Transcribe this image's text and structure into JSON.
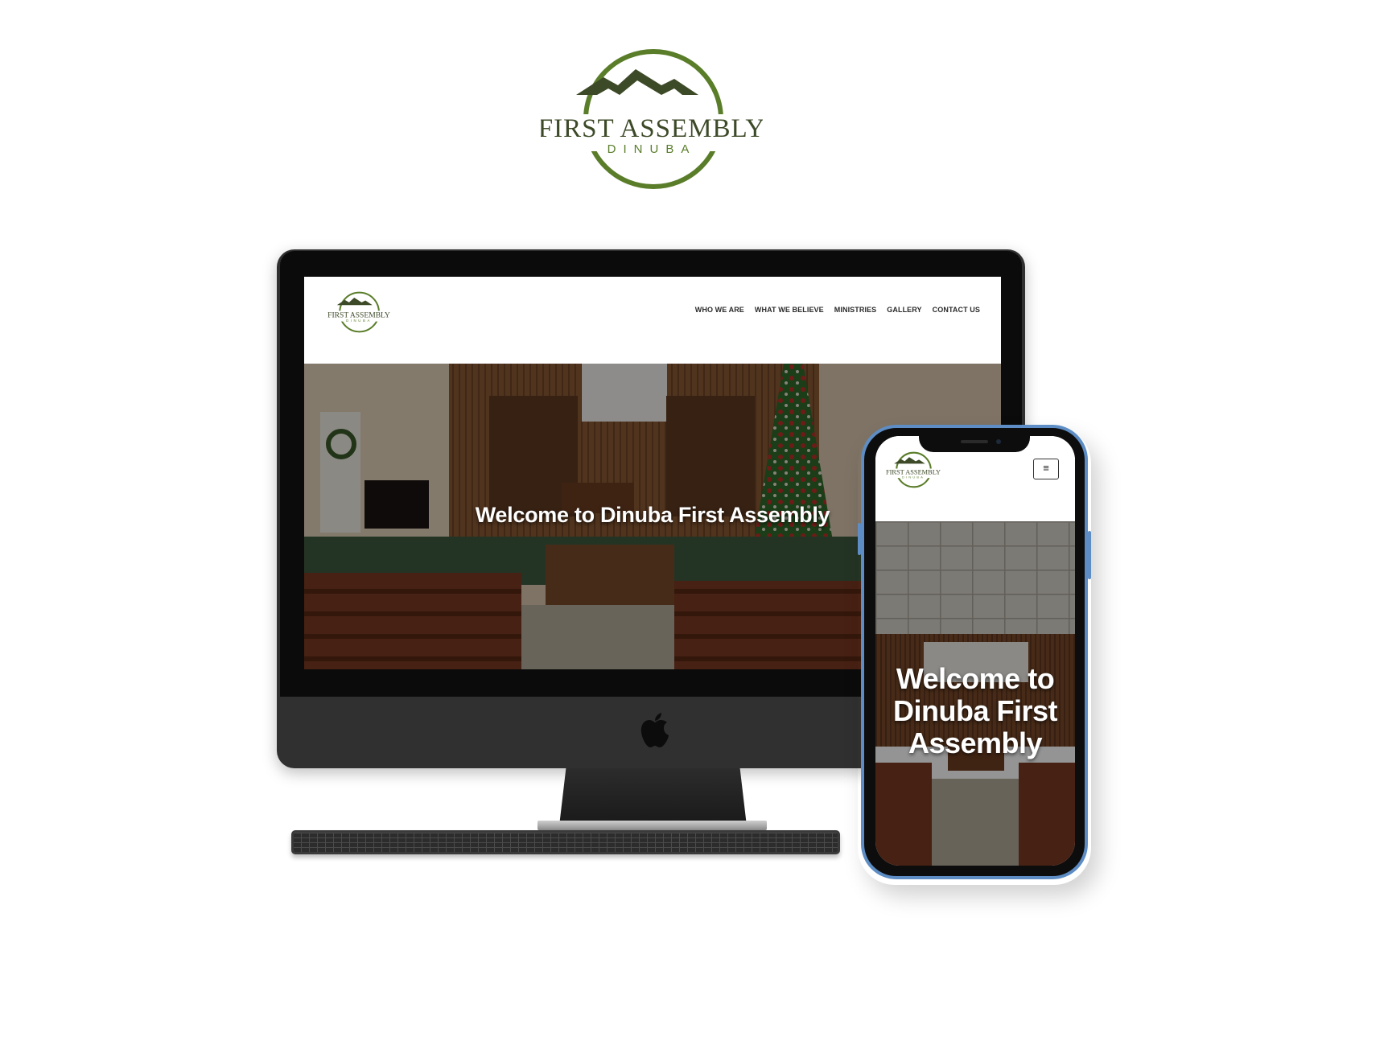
{
  "brand": {
    "name": "FIRST ASSEMBLY",
    "subname": "DINUBA",
    "color_primary": "#5a7d2a",
    "color_dark": "#3d4a28"
  },
  "desktop_site": {
    "nav": {
      "items": [
        "WHO WE ARE",
        "WHAT WE BELIEVE",
        "MINISTRIES",
        "GALLERY",
        "CONTACT US"
      ]
    },
    "hero": {
      "title": "Welcome to Dinuba First Assembly"
    }
  },
  "mobile_site": {
    "menu_icon": "hamburger-icon",
    "menu_glyph": "≡",
    "hero": {
      "title": "Welcome to Dinuba First Assembly"
    }
  },
  "devices": {
    "imac_frame_color": "#303030",
    "iphone_frame_color": "#5d8dc4"
  }
}
